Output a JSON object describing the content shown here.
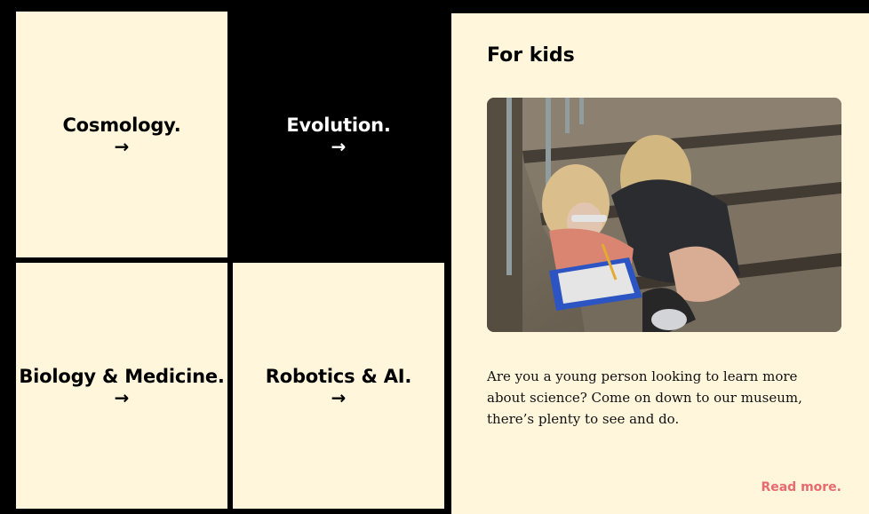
{
  "tiles": [
    {
      "title": "Cosmology.",
      "arrow": "→",
      "theme": "light"
    },
    {
      "title": "Evolution.",
      "arrow": "→",
      "theme": "dark"
    },
    {
      "title": "Biology & Medicine.",
      "arrow": "→",
      "theme": "light"
    },
    {
      "title": "Robotics & AI.",
      "arrow": "→",
      "theme": "light"
    }
  ],
  "kids_panel": {
    "heading": "For kids",
    "image_alt": "Two children reading a clipboard on stone steps",
    "body": "Are you a young person looking to learn more about science? Come on down to our museum, there’s plenty to see and do.",
    "read_more": "Read more."
  },
  "colors": {
    "background": "#000000",
    "tile_light": "#fff6dc",
    "accent_link": "#e86a6e"
  }
}
